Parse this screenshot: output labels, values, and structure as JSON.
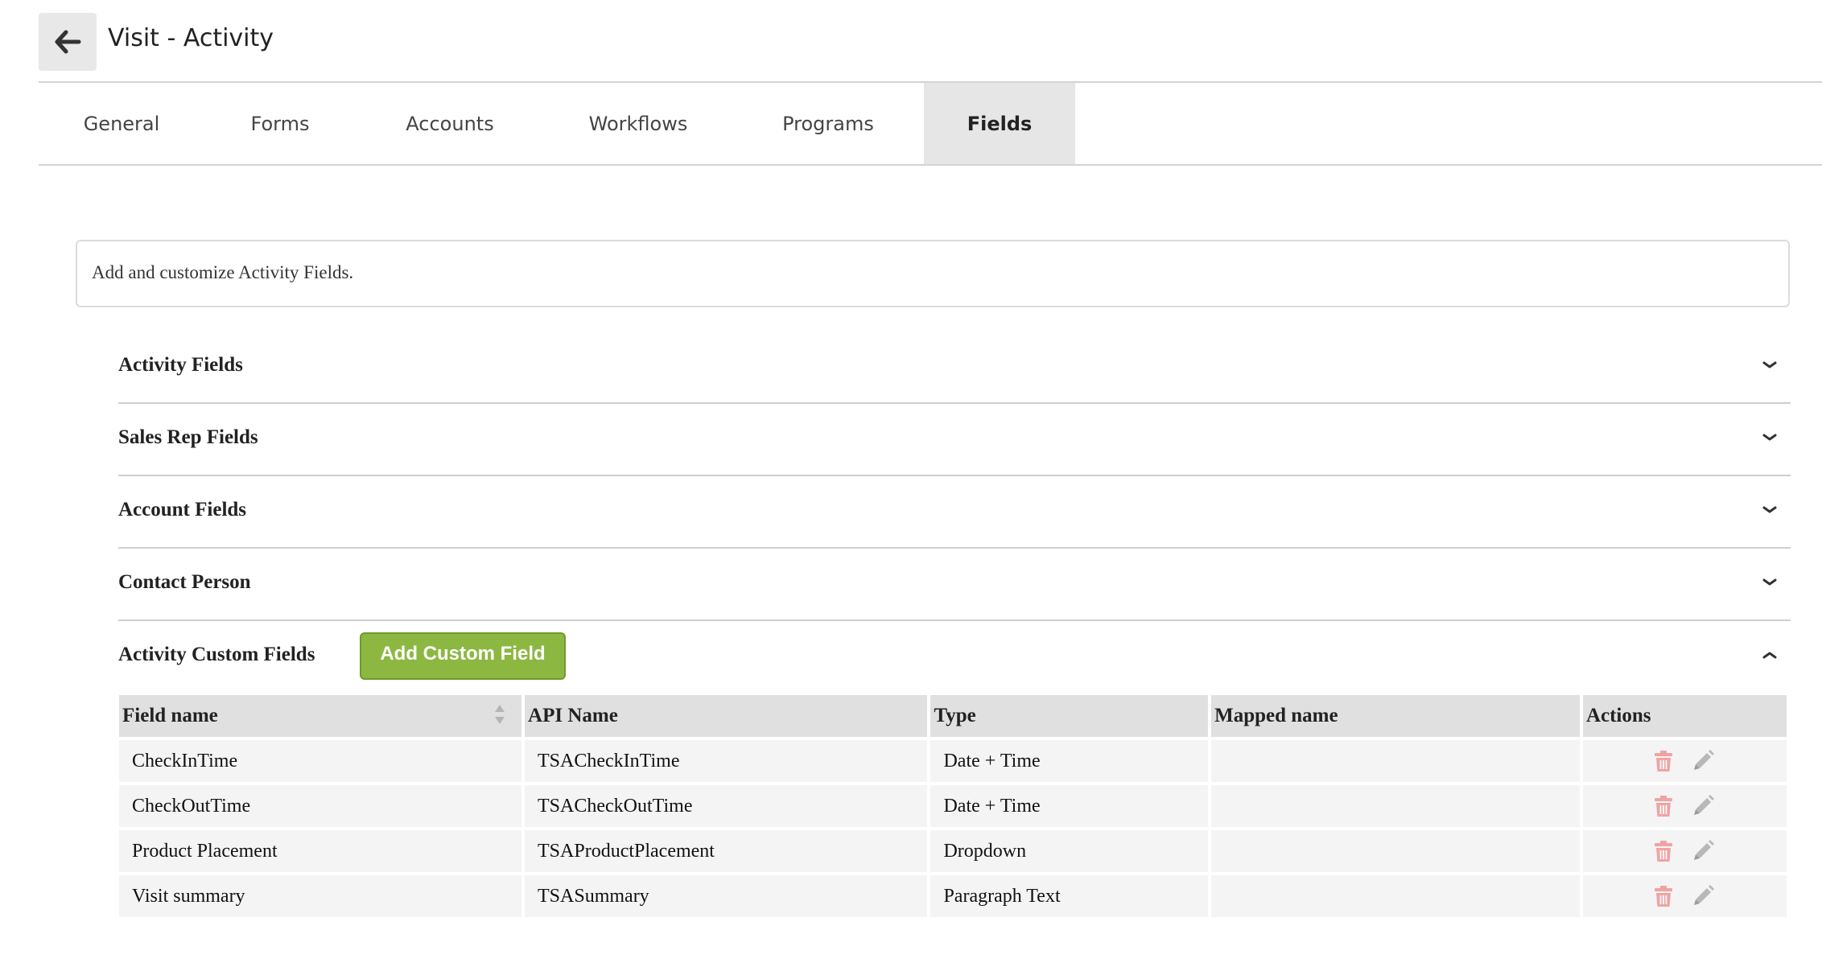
{
  "header": {
    "title": "Visit - Activity"
  },
  "tabs": [
    {
      "label": "General"
    },
    {
      "label": "Forms"
    },
    {
      "label": "Accounts"
    },
    {
      "label": "Workflows"
    },
    {
      "label": "Programs"
    },
    {
      "label": "Fields",
      "active": true
    }
  ],
  "info": {
    "text": "Add and customize Activity Fields."
  },
  "sections": [
    {
      "title": "Activity Fields",
      "expanded": false
    },
    {
      "title": "Sales Rep Fields",
      "expanded": false
    },
    {
      "title": "Account Fields",
      "expanded": false
    },
    {
      "title": "Contact Person",
      "expanded": false
    },
    {
      "title": "Activity Custom Fields",
      "expanded": true,
      "button_label": "Add Custom Field"
    }
  ],
  "table": {
    "columns": [
      "Field name",
      "API Name",
      "Type",
      "Mapped name",
      "Actions"
    ],
    "rows": [
      {
        "field_name": "CheckInTime",
        "api_name": "TSACheckInTime",
        "type": "Date + Time",
        "mapped_name": ""
      },
      {
        "field_name": "CheckOutTime",
        "api_name": "TSACheckOutTime",
        "type": "Date + Time",
        "mapped_name": ""
      },
      {
        "field_name": "Product Placement",
        "api_name": "TSAProductPlacement",
        "type": "Dropdown",
        "mapped_name": ""
      },
      {
        "field_name": "Visit summary",
        "api_name": "TSASummary",
        "type": "Paragraph Text",
        "mapped_name": ""
      }
    ]
  },
  "colors": {
    "accent_green": "#8cb842",
    "delete_icon": "#f0a3a3",
    "edit_icon": "#b8b8b8",
    "active_tab_bg": "#e6e6e6"
  },
  "icons": {
    "back": "arrow-left-icon",
    "collapse": "chevron-down-icon",
    "expand": "chevron-up-icon",
    "delete": "trash-icon",
    "edit": "pencil-icon",
    "sort": "sort-icon"
  }
}
